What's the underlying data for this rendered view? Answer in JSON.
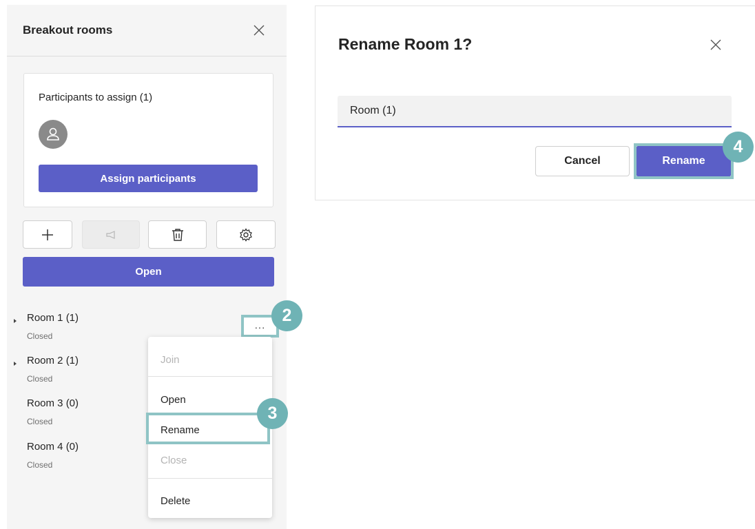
{
  "panel": {
    "title": "Breakout rooms",
    "assign_card": {
      "title": "Participants to assign (1)",
      "assign_button": "Assign participants"
    },
    "toolbar": {
      "add_icon": "plus-icon",
      "announce_icon": "megaphone-icon",
      "delete_icon": "trash-icon",
      "settings_icon": "gear-icon"
    },
    "open_button": "Open",
    "rooms": [
      {
        "name": "Room 1  (1)",
        "status": "Closed"
      },
      {
        "name": "Room 2  (1)",
        "status": "Closed"
      },
      {
        "name": "Room 3  (0)",
        "status": "Closed"
      },
      {
        "name": "Room 4  (0)",
        "status": "Closed"
      }
    ],
    "room_more": "...",
    "menu": {
      "join": "Join",
      "open": "Open",
      "rename": "Rename",
      "close": "Close",
      "delete": "Delete"
    }
  },
  "dialog": {
    "title": "Rename Room 1?",
    "input_value": "Room (1)",
    "cancel": "Cancel",
    "rename": "Rename"
  },
  "badges": {
    "step2": "2",
    "step3": "3",
    "step4": "4"
  },
  "colors": {
    "accent": "#5b5fc7",
    "highlight": "#8fc4c5",
    "badge": "#6fb3b5"
  }
}
